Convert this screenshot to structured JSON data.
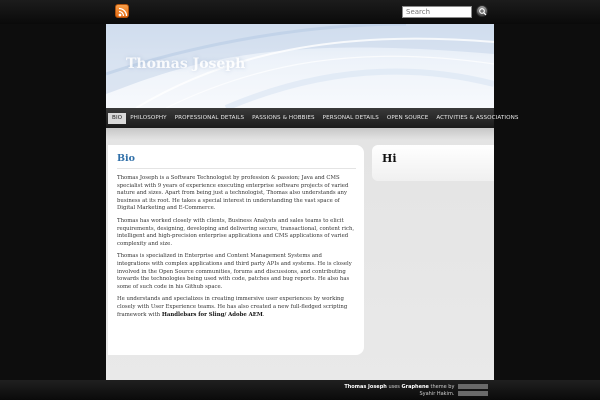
{
  "topbar": {
    "rss_icon": "rss-icon",
    "search_placeholder": "Search",
    "search_icon": "search-icon"
  },
  "header": {
    "site_title": "Thomas Joseph"
  },
  "nav": {
    "items": [
      {
        "label": "BIO",
        "active": true
      },
      {
        "label": "PHILOSOPHY"
      },
      {
        "label": "PROFESSIONAL DETAILS"
      },
      {
        "label": "PASSIONS & HOBBIES"
      },
      {
        "label": "PERSONAL DETAILS"
      },
      {
        "label": "OPEN SOURCE"
      },
      {
        "label": "ACTIVITIES & ASSOCIATIONS"
      }
    ]
  },
  "content": {
    "title": "Bio",
    "paragraphs": [
      "Thomas Joseph is a Software Technologist by profession & passion; Java and CMS specialist with 9 years of experience executing enterprise software projects of varied nature and sizes. Apart from being just a technologist, Thomas also understands any business at its root. He takes a special interest in understanding the vast space of Digital Marketing and E-Commerce.",
      "Thomas has worked closely with clients, Business Analysts and sales teams to elicit requirements, designing, developing and delivering secure, transactional, content rich, intelligent and high-precision enterprise applications and CMS applications of varied complexity and size.",
      "Thomas is specialized in Enterprise and Content Management Systems and integrations with complex applications and third party APIs and systems. He is closely involved in the Open Source communities, forums and discussions, and contributing towards the technologies being used with code, patches and bug reports. He also has some of such code in his Github space.",
      "He understands and specializes in creating immersive user experiences by working closely with User Experience teams. He has also created a new full-fledged scripting framework with"
    ],
    "para4_bold": "Handlebars for Sling/ Adobe AEM",
    "para4_end": "."
  },
  "sidebar": {
    "widget_title": "Hi"
  },
  "footer": {
    "author": "Thomas Joseph",
    "uses": "uses",
    "theme": "Graphene",
    "theme_by": "theme by",
    "designer": "Syahir Hakim."
  },
  "colors": {
    "title_blue": "#2f6fa8",
    "rss_orange": "#e56a12"
  }
}
